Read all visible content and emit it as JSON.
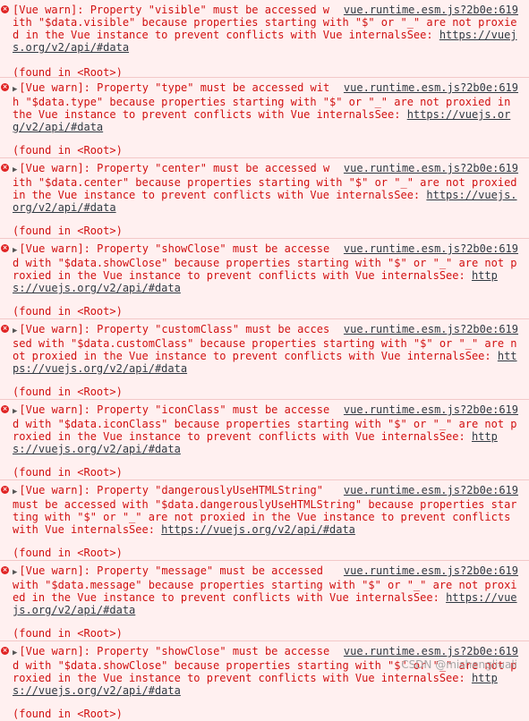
{
  "console": {
    "entries": [
      {
        "has_toggle": false,
        "message": "[Vue warn]: Property \"visible\" must be accessed with \"$data.visible\" because properties starting with \"$\" or \"_\" are not proxied in the Vue instance to prevent conflicts with Vue internalsSee: ",
        "link": "https://vuejs.org/v2/api/#data",
        "source": "vue.runtime.esm.js?2b0e:619",
        "found": "(found in <Root>)"
      },
      {
        "has_toggle": true,
        "message": "[Vue warn]: Property \"type\" must be accessed with \"$data.type\" because properties starting with \"$\" or \"_\" are not proxied in the Vue instance to prevent conflicts with Vue internalsSee: ",
        "link": "https://vuejs.org/v2/api/#data",
        "source": "vue.runtime.esm.js?2b0e:619",
        "found": "(found in <Root>)"
      },
      {
        "has_toggle": true,
        "message": "[Vue warn]: Property \"center\" must be accessed with \"$data.center\" because properties starting with \"$\" or \"_\" are not proxied in the Vue instance to prevent conflicts with Vue internalsSee: ",
        "link": "https://vuejs.org/v2/api/#data",
        "source": "vue.runtime.esm.js?2b0e:619",
        "found": "(found in <Root>)"
      },
      {
        "has_toggle": true,
        "message": "[Vue warn]: Property \"showClose\" must be accessed with \"$data.showClose\" because properties starting with \"$\" or \"_\" are not proxied in the Vue instance to prevent conflicts with Vue internalsSee: ",
        "link": "https://vuejs.org/v2/api/#data",
        "source": "vue.runtime.esm.js?2b0e:619",
        "found": "(found in <Root>)"
      },
      {
        "has_toggle": true,
        "message": "[Vue warn]: Property \"customClass\" must be accessed with \"$data.customClass\" because properties starting with \"$\" or \"_\" are not proxied in the Vue instance to prevent conflicts with Vue internalsSee: ",
        "link": "https://vuejs.org/v2/api/#data",
        "source": "vue.runtime.esm.js?2b0e:619",
        "found": "(found in <Root>)"
      },
      {
        "has_toggle": true,
        "message": "[Vue warn]: Property \"iconClass\" must be accessed with \"$data.iconClass\" because properties starting with \"$\" or \"_\" are not proxied in the Vue instance to prevent conflicts with Vue internalsSee: ",
        "link": "https://vuejs.org/v2/api/#data",
        "source": "vue.runtime.esm.js?2b0e:619",
        "found": "(found in <Root>)"
      },
      {
        "has_toggle": true,
        "message": "[Vue warn]: Property \"dangerouslyUseHTMLString\" must be accessed with \"$data.dangerouslyUseHTMLString\" because properties starting with \"$\" or \"_\" are not proxied in the Vue instance to prevent conflicts with Vue internalsSee: ",
        "link": "https://vuejs.org/v2/api/#data",
        "source": "vue.runtime.esm.js?2b0e:619",
        "found": "(found in <Root>)"
      },
      {
        "has_toggle": true,
        "message": "[Vue warn]: Property \"message\" must be accessed with \"$data.message\" because properties starting with \"$\" or \"_\" are not proxied in the Vue instance to prevent conflicts with Vue internalsSee: ",
        "link": "https://vuejs.org/v2/api/#data",
        "source": "vue.runtime.esm.js?2b0e:619",
        "found": "(found in <Root>)"
      },
      {
        "has_toggle": true,
        "message": "[Vue warn]: Property \"showClose\" must be accessed with \"$data.showClose\" because properties starting with \"$\" or \"_\" are not proxied in the Vue instance to prevent conflicts with Vue internalsSee: ",
        "link": "https://vuejs.org/v2/api/#data",
        "source": "vue.runtime.esm.js?2b0e:619",
        "found": "(found in <Root>)"
      }
    ],
    "error_icon": "error-icon",
    "toggle_icon": "triangle-right-icon"
  },
  "watermark": "CSDN @mishengliuali"
}
